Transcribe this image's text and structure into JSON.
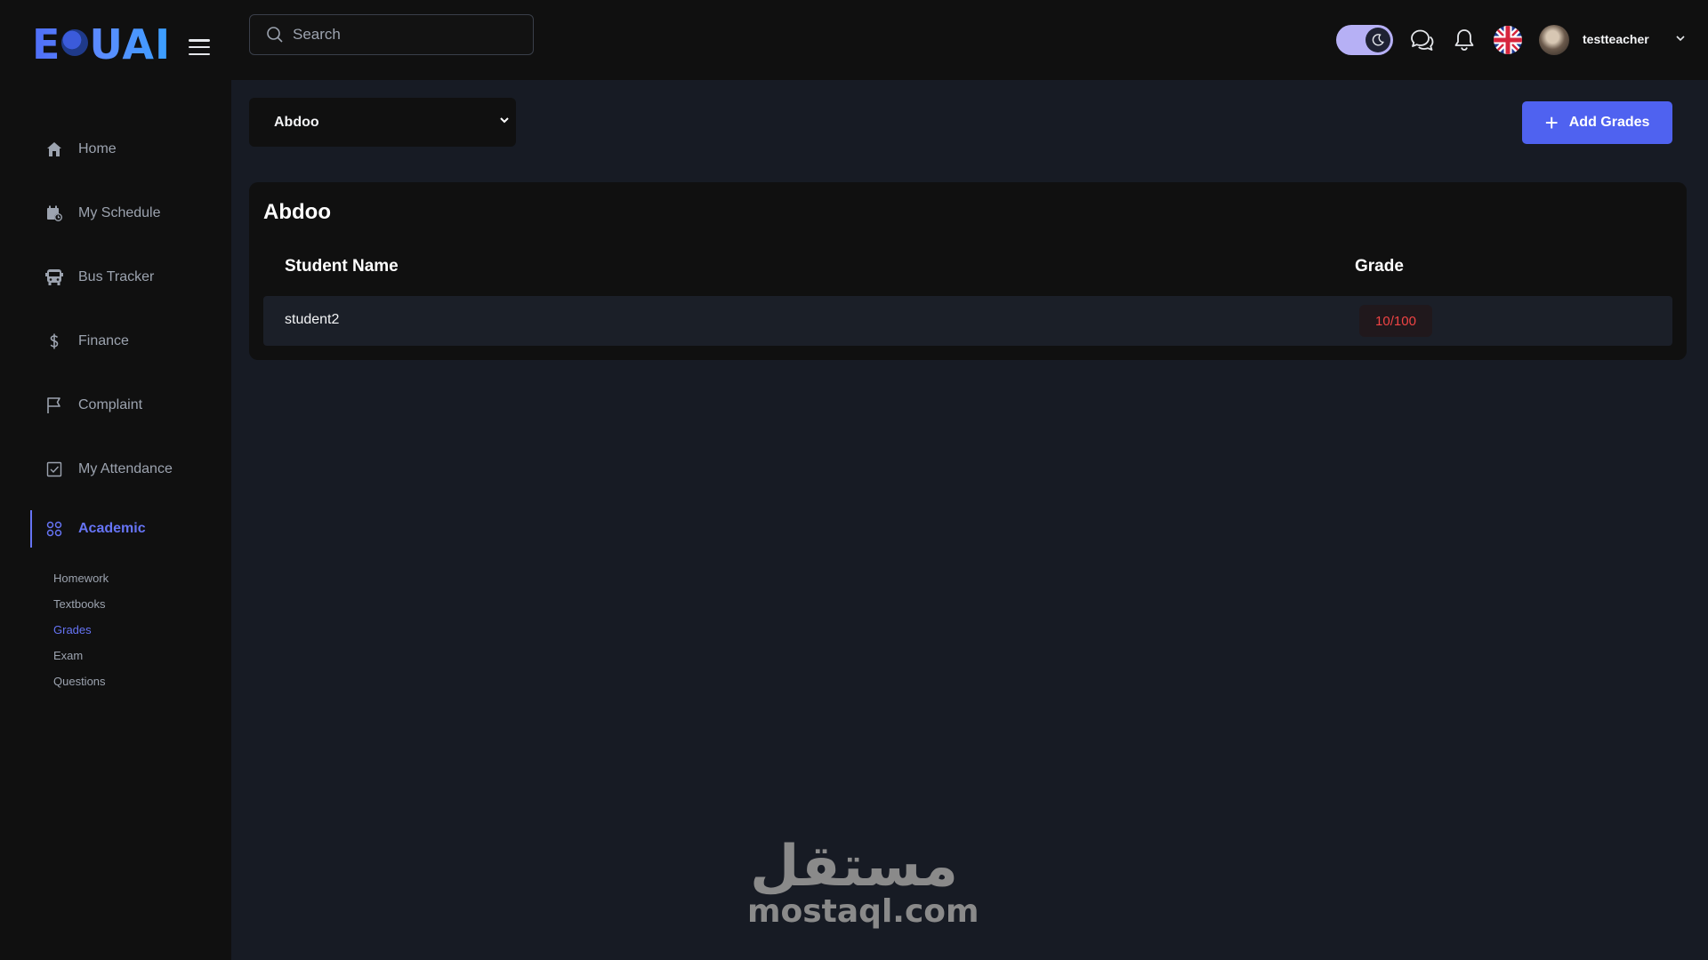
{
  "brand": {
    "logo_text": "EDUAI"
  },
  "search": {
    "placeholder": "Search"
  },
  "user": {
    "name": "testteacher"
  },
  "sidebar": {
    "items": [
      {
        "label": "Home",
        "icon": "home-icon"
      },
      {
        "label": "My Schedule",
        "icon": "calendar-clock-icon"
      },
      {
        "label": "Bus Tracker",
        "icon": "bus-icon"
      },
      {
        "label": "Finance",
        "icon": "dollar-icon"
      },
      {
        "label": "Complaint",
        "icon": "flag-icon"
      },
      {
        "label": "My Attendance",
        "icon": "checkbox-icon"
      }
    ],
    "active_section": {
      "label": "Academic",
      "icon": "grid-icon"
    },
    "subitems": [
      {
        "label": "Homework"
      },
      {
        "label": "Textbooks"
      },
      {
        "label": "Grades",
        "active": true
      },
      {
        "label": "Exam"
      },
      {
        "label": "Questions"
      }
    ]
  },
  "main": {
    "selected_class": "Abdoo",
    "add_button": "Add Grades",
    "card": {
      "title": "Abdoo",
      "columns": [
        "Student Name",
        "Grade"
      ],
      "rows": [
        {
          "student": "student2",
          "grade": "10/100"
        }
      ]
    }
  },
  "watermark": {
    "arabic": "مستقل",
    "latin": "mostaql.com"
  },
  "colors": {
    "accent": "#4f62f0",
    "active_nav": "#6674f5",
    "grade_bad": "#ef4444",
    "background": "#171b24",
    "panel": "#101010"
  }
}
